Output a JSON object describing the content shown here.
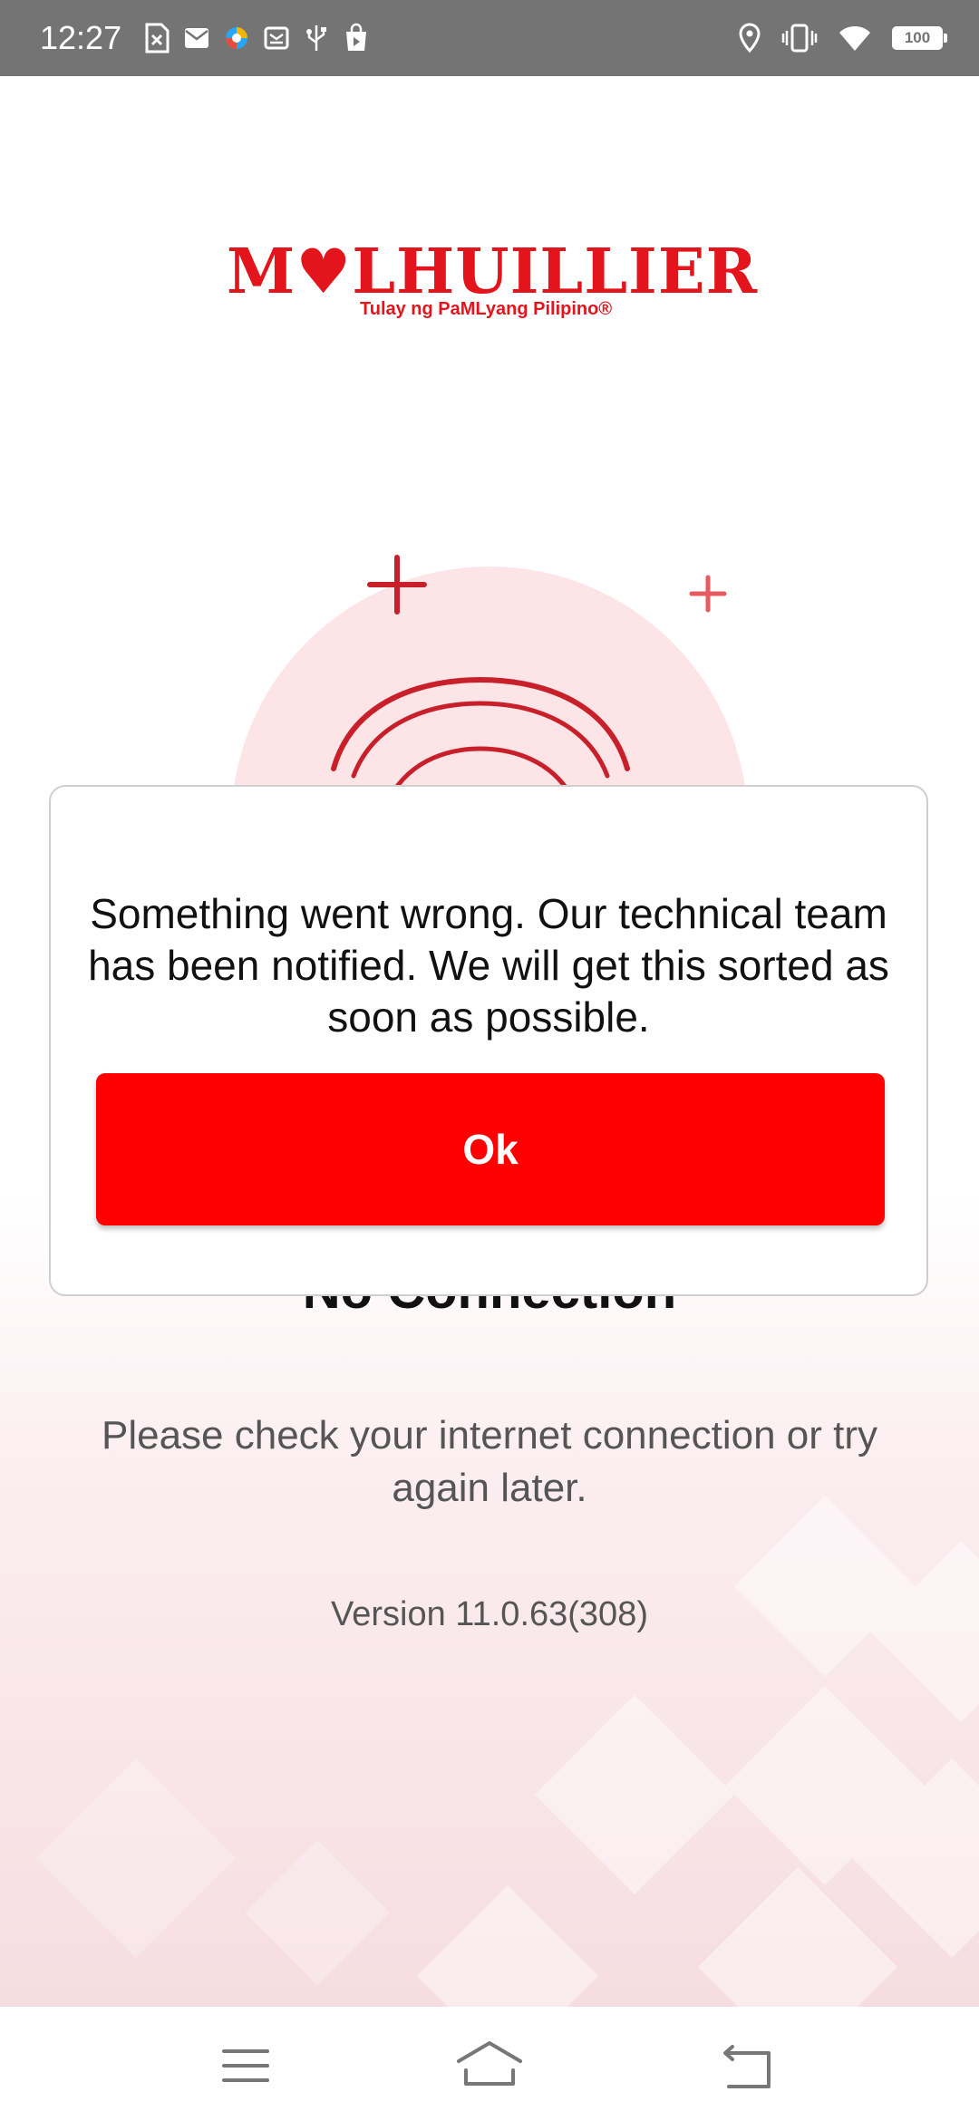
{
  "status_bar": {
    "time": "12:27",
    "left_icons": [
      "sim-error-icon",
      "mail-icon",
      "browser-icon",
      "inbox-icon",
      "usb-icon",
      "shopping-bag-icon"
    ],
    "right_icons": [
      "location-icon",
      "vibrate-icon",
      "wifi-icon",
      "battery-icon"
    ],
    "battery": "100"
  },
  "logo": {
    "word": "M♥LHUILLIER",
    "tagline": "Tulay ng PaMLyang Pilipino®"
  },
  "main": {
    "title": "No Connection",
    "message": "Please check your internet connection or try again later.",
    "version": "Version 11.0.63(308)"
  },
  "dialog": {
    "message": "Something went wrong. Our technical team has been notified. We will get this sorted as soon as possible.",
    "ok_label": "Ok"
  },
  "nav_bar": {
    "buttons": [
      "menu-icon",
      "home-icon",
      "back-icon"
    ]
  },
  "colors": {
    "brand_red": "#e3141c",
    "button_red": "#ff0000",
    "status_bar": "#747474"
  }
}
